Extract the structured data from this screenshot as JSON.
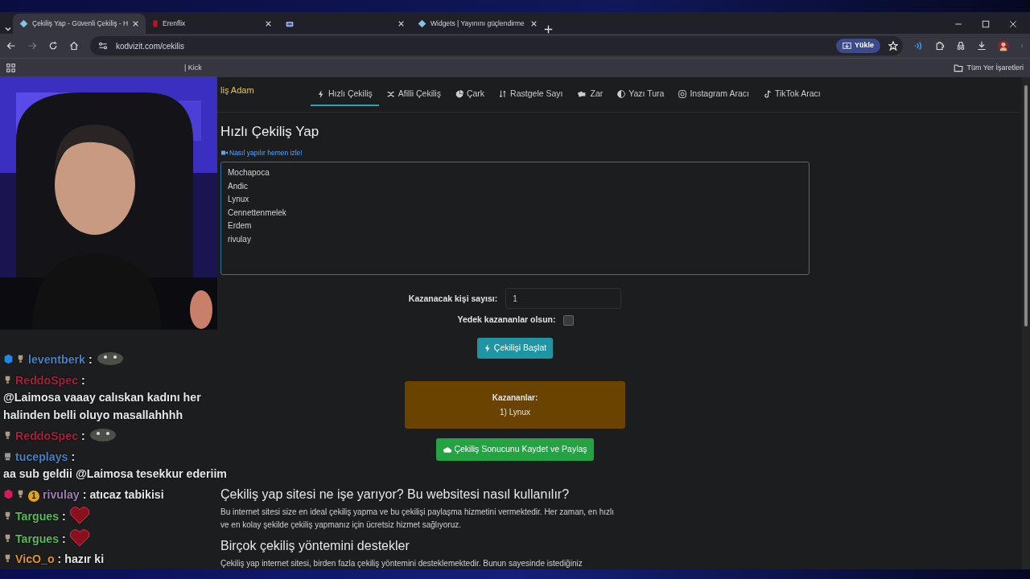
{
  "browser": {
    "tabs": [
      {
        "title": "Çekiliş Yap - Güvenli Çekiliş - H",
        "kind": "diamond",
        "selected": true
      },
      {
        "title": "Erenflix",
        "kind": "letter",
        "selected": false
      },
      {
        "kind": "screen",
        "selected": false
      },
      {
        "title": "Widgets | Yayınını güçlendirme",
        "kind": "diamond",
        "selected": false
      }
    ],
    "address": "kodvizit.com/cekilis",
    "install_button": "Yükle",
    "bookmarks": [
      "| Kick"
    ],
    "all_bookmarks": "Tüm Yer İşaretleri"
  },
  "site": {
    "brand": "liş Adam",
    "nav": [
      {
        "label": "Hızlı Çekiliş",
        "kind": "bolt",
        "selected": true
      },
      {
        "label": "Afilli Çekiliş",
        "kind": "shuffle",
        "selected": false
      },
      {
        "label": "Çark",
        "kind": "pie",
        "selected": false
      },
      {
        "label": "Rastgele Sayı",
        "kind": "sort",
        "selected": false
      },
      {
        "label": "Zar",
        "kind": "dice",
        "selected": false
      },
      {
        "label": "Yazı Tura",
        "kind": "half",
        "selected": false
      },
      {
        "label": "Instagram Aracı",
        "kind": "instagram",
        "selected": false
      },
      {
        "label": "TikTok Aracı",
        "kind": "tiktok",
        "selected": false
      }
    ],
    "title": "Hızlı Çekiliş Yap",
    "video_link": "Nasıl yapılır hemen izle!",
    "participants": [
      "Mochapoca",
      "Andic",
      "Lynux",
      "Cennettenmelek",
      "Erdem",
      "rivulay"
    ],
    "winner_count_label": "Kazanacak kişi sayısı:",
    "winner_count": "1",
    "backup_label": "Yedek kazananlar olsun:",
    "backup_checked": false,
    "start_button": "Çekilişi Başlat",
    "winners_title": "Kazananlar:",
    "winners": [
      "1) Lynux"
    ],
    "share_button": "Çekiliş Sonucunu Kaydet ve Paylaş",
    "sections": [
      {
        "heading": "Çekiliş yap sitesi ne işe yarıyor? Bu websitesi nasıl kullanılır?",
        "text": "Bu internet sitesi size en ideal çekiliş yapma ve bu çekilişi paylaşma hizmetini vermektedir. Her zaman, en hızlı ve en kolay şekilde çekiliş yapmanız için ücretsiz hizmet sağlıyoruz."
      },
      {
        "heading": "Birçok çekiliş yöntemini destekler",
        "text": "Çekiliş yap internet sitesi, birden fazla çekiliş yöntemini desteklemektedir. Bunun sayesinde istediğiniz"
      }
    ]
  },
  "chat": [
    {
      "user": "leventberk",
      "color": "#4a7fc1",
      "badges": [
        {
          "kind": "cube",
          "color": "#1e88e5"
        },
        {
          "kind": "cup"
        }
      ],
      "separator": ":",
      "kind": "emote"
    },
    {
      "user": "ReddoSpec",
      "color": "#a3213a",
      "badges": [
        {
          "kind": "cup"
        }
      ],
      "separator": ":",
      "kind": "text",
      "text": "@Laimosa vaaay calıskan kadını her halinden belli oluyo masallahhhh"
    },
    {
      "user": "ReddoSpec",
      "color": "#a3213a",
      "badges": [
        {
          "kind": "cup"
        }
      ],
      "separator": ":",
      "kind": "emote"
    },
    {
      "user": "tuceplays",
      "color": "#4a7fc1",
      "badges": [
        {
          "kind": "robot"
        }
      ],
      "separator": ":",
      "kind": "text",
      "text": "aa sub geldii @Laimosa tesekkur ederiim"
    },
    {
      "user": "rivulay",
      "color": "#9a7fb0",
      "badges": [
        {
          "kind": "cube",
          "color": "#d81b60"
        },
        {
          "kind": "cup"
        },
        {
          "kind": "coin",
          "label": "1"
        }
      ],
      "separator": ":",
      "kind": "text",
      "text": "atıcaz tabikisi"
    },
    {
      "user": "Targues",
      "color": "#5cb85c",
      "badges": [
        {
          "kind": "cup"
        }
      ],
      "separator": ":",
      "kind": "heart"
    },
    {
      "user": "Targues",
      "color": "#5cb85c",
      "badges": [
        {
          "kind": "cup"
        }
      ],
      "separator": ":",
      "kind": "heart"
    },
    {
      "user": "VicO_o",
      "color": "#e0902a",
      "badges": [
        {
          "kind": "cup"
        }
      ],
      "separator": ":",
      "kind": "text",
      "text": "hazır ki"
    }
  ]
}
